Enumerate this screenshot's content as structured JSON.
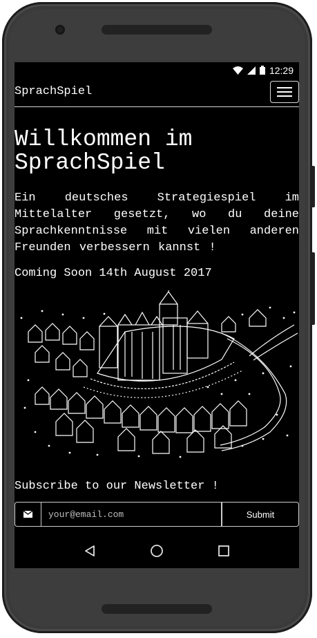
{
  "status_bar": {
    "time": "12:29",
    "icons": [
      "wifi-icon",
      "cell-signal-icon",
      "battery-icon"
    ]
  },
  "navbar": {
    "brand": "SprachSpiel",
    "menu_icon": "hamburger-menu-icon"
  },
  "hero": {
    "title": "Willkommen im SprachSpiel",
    "description": "Ein deutsches Strategiespiel im Mittelalter gesetzt, wo du deine Sprachkenntnisse mit vielen anderen Freunden verbessern kannst !",
    "coming_soon": "Coming Soon 14th August 2017",
    "image": "medieval-town-sketch"
  },
  "newsletter": {
    "heading": "Subscribe to our Newsletter !",
    "email_placeholder": "your@email.com",
    "email_value": "",
    "submit_label": "Submit",
    "addon_icon": "envelope-icon"
  },
  "android_nav": {
    "buttons": [
      "back-icon",
      "home-icon",
      "recents-icon"
    ]
  },
  "colors": {
    "screen_background": "#000000",
    "text": "#ffffff",
    "frame": "#3d3d3d",
    "border": "#cccccc"
  }
}
